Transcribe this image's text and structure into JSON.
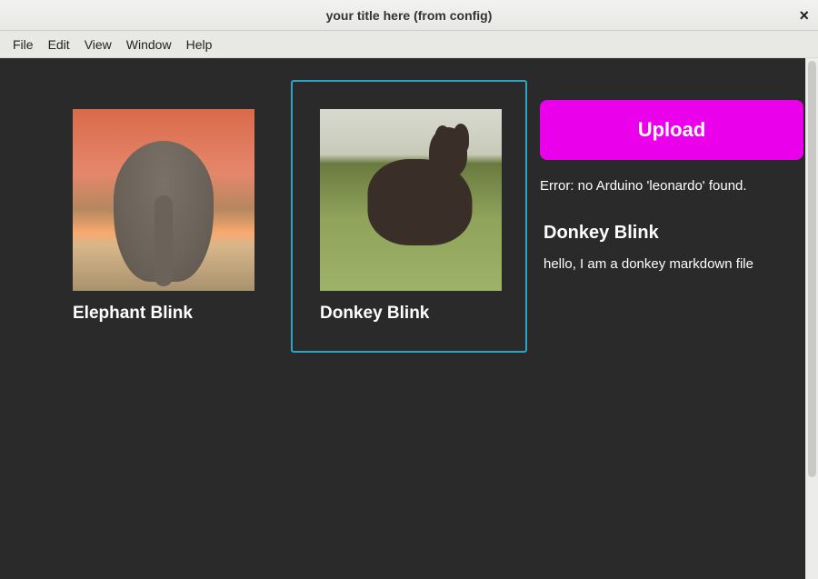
{
  "window": {
    "title": "your title here (from config)"
  },
  "menu": {
    "items": [
      "File",
      "Edit",
      "View",
      "Window",
      "Help"
    ]
  },
  "cards": [
    {
      "title": "Elephant Blink",
      "image_name": "elephant-thumb",
      "selected": false
    },
    {
      "title": "Donkey Blink",
      "image_name": "donkey-thumb",
      "selected": true
    }
  ],
  "panel": {
    "upload_label": "Upload",
    "error": "Error: no Arduino 'leonardo' found.",
    "title": "Donkey Blink",
    "description": "hello, I am a donkey markdown file"
  },
  "colors": {
    "accent": "#ea00ea",
    "selection": "#2ea3c4",
    "bg_dark": "#2a2a2a"
  }
}
